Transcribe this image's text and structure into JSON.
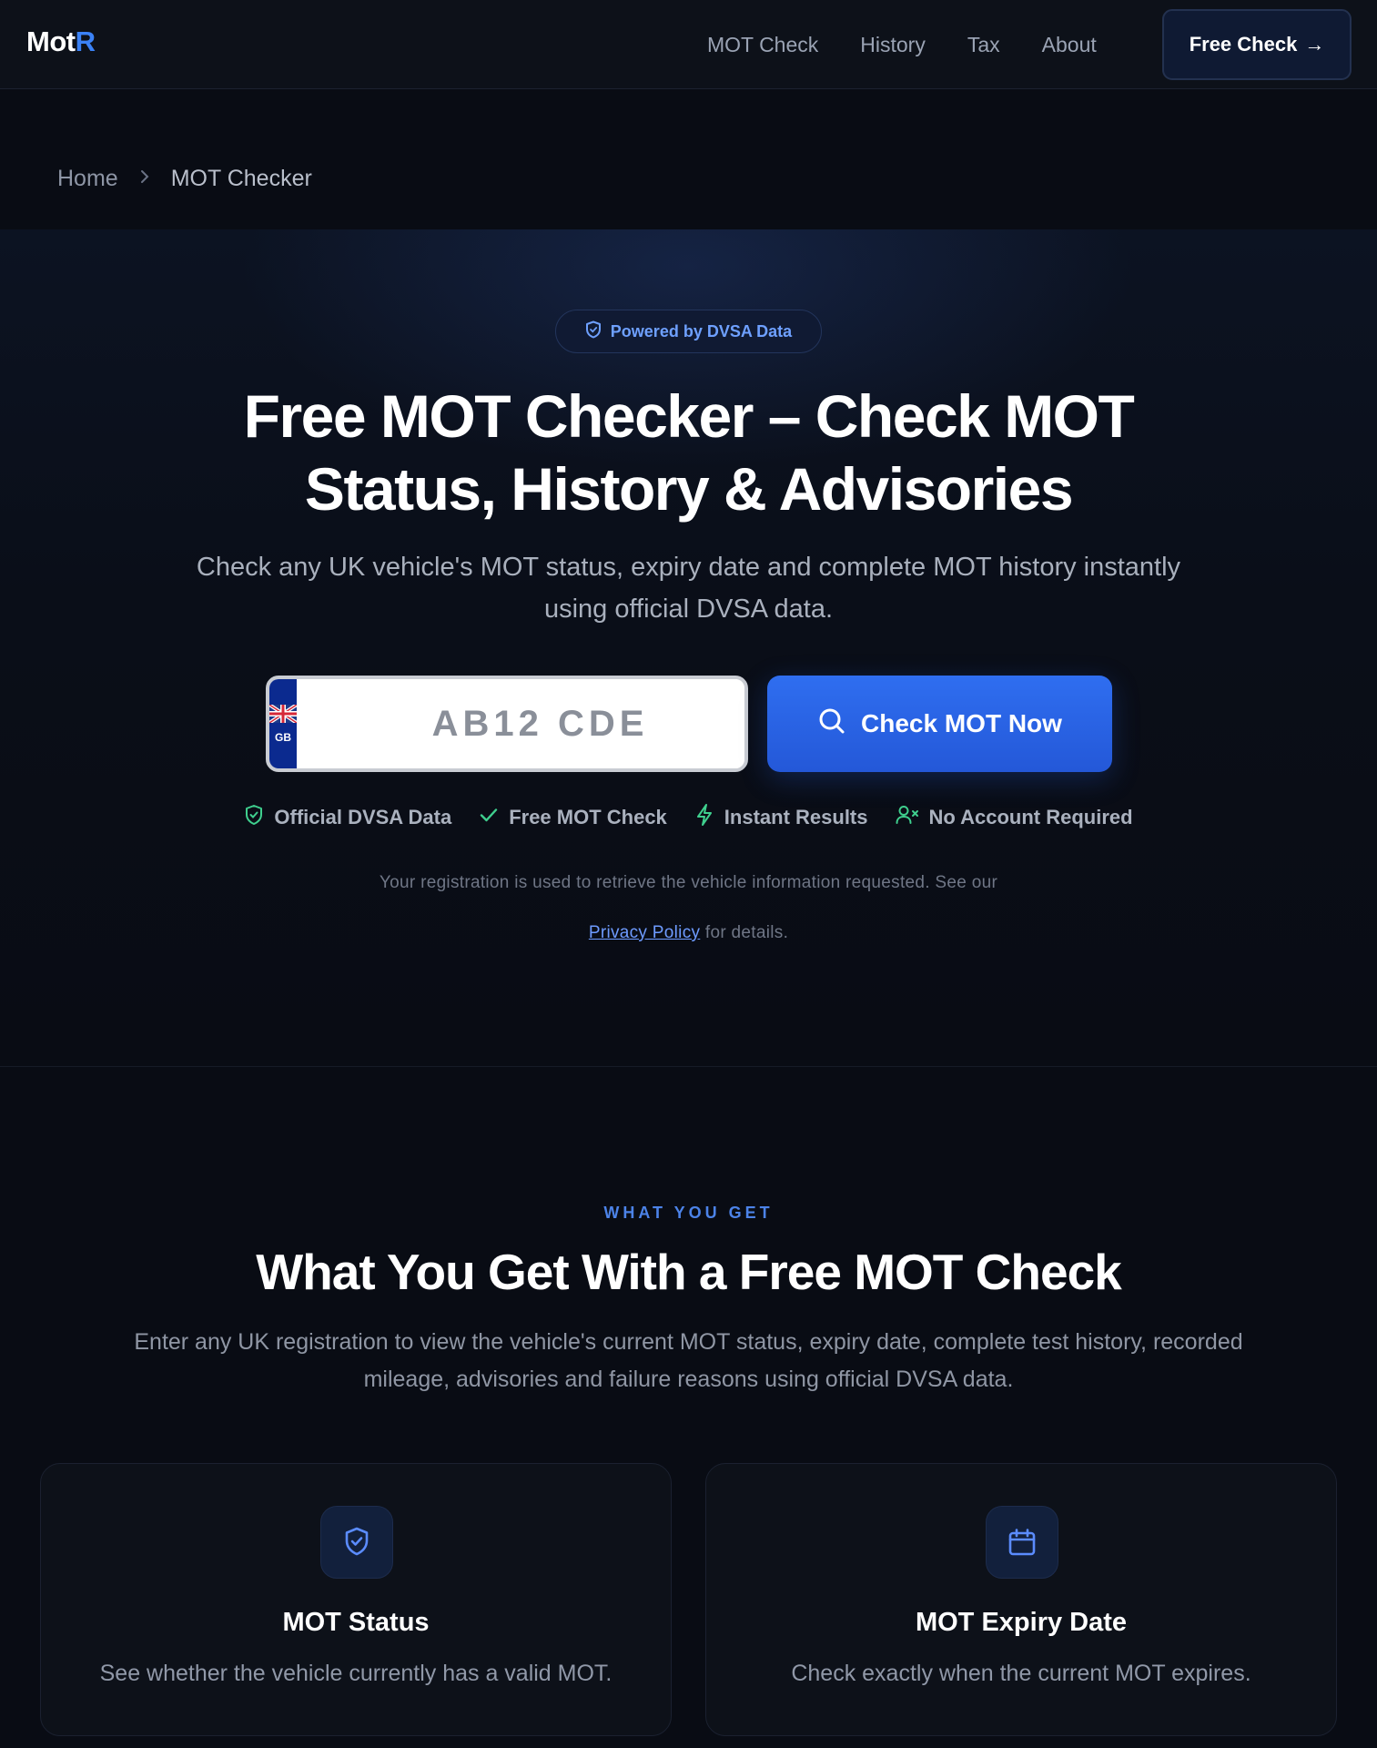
{
  "nav": {
    "logo_main": "Mot",
    "logo_accent": "R",
    "links": [
      "MOT Check",
      "History",
      "Tax",
      "About"
    ],
    "cta_label": "Free Check",
    "cta_arrow": "→"
  },
  "breadcrumb": {
    "home": "Home",
    "separator": "›",
    "current": "MOT Checker"
  },
  "hero": {
    "badge": "Powered by DVSA Data",
    "title": "Free MOT Checker – Check MOT Status, History & Advisories",
    "lead": "Check any UK vehicle's MOT status, expiry date and complete MOT history instantly using official DVSA data.",
    "plate_country": "GB",
    "plate_placeholder": "AB12 CDE",
    "check_button": "Check MOT Now",
    "features": [
      "Official DVSA Data",
      "Free MOT Check",
      "Instant Results",
      "No Account Required"
    ],
    "notice_text": "Your registration is used to retrieve the vehicle information requested. See our",
    "notice_link": "Privacy Policy",
    "notice_tail": "for details."
  },
  "section": {
    "eyebrow": "WHAT YOU GET",
    "title": "What You Get With a Free MOT Check",
    "subtitle": "Enter any UK registration to view the vehicle's current MOT status, expiry date, complete test history, recorded mileage, advisories and failure reasons using official DVSA data.",
    "cards": [
      {
        "title": "MOT Status",
        "text": "See whether the vehicle currently has a valid MOT.",
        "icon": "shield-check-icon"
      },
      {
        "title": "MOT Expiry Date",
        "text": "Check exactly when the current MOT expires.",
        "icon": "calendar-icon"
      }
    ]
  },
  "colors": {
    "background": "#090c14",
    "accent": "#3b82f6",
    "button": "#2563eb"
  }
}
